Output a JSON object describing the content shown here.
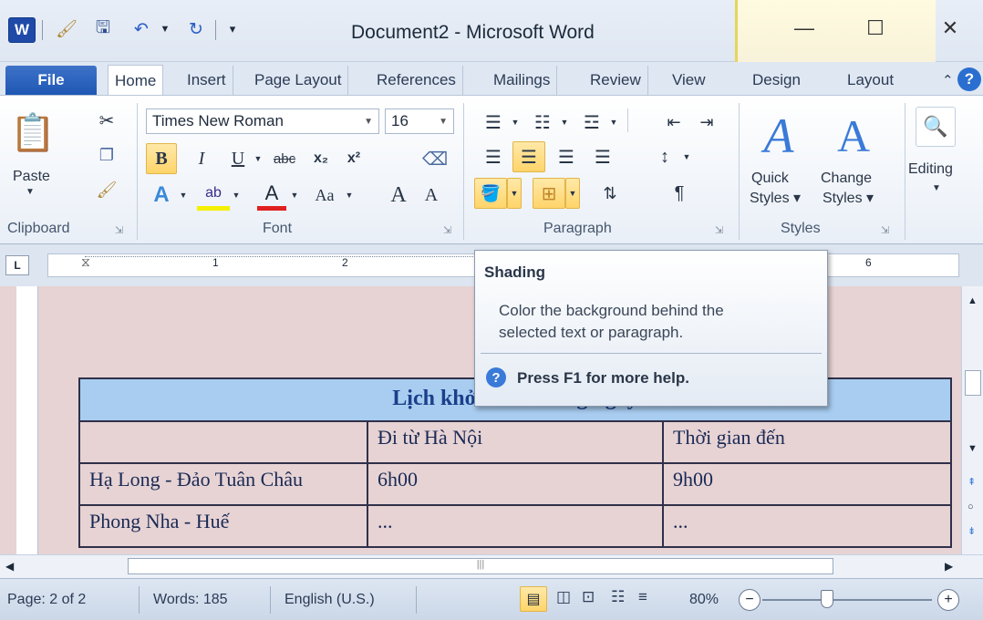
{
  "title_bar": {
    "document_title": "Document2 - Microsoft Word",
    "app_icon_letter": "W",
    "minimize_glyph": "—",
    "maximize_glyph": "☐",
    "close_glyph": "✕"
  },
  "tabs": [
    {
      "label": "File"
    },
    {
      "label": "Home"
    },
    {
      "label": "Insert"
    },
    {
      "label": "Page Layout"
    },
    {
      "label": "References"
    },
    {
      "label": "Mailings"
    },
    {
      "label": "Review"
    },
    {
      "label": "View"
    },
    {
      "label": "Design"
    },
    {
      "label": "Layout"
    }
  ],
  "ribbon": {
    "clipboard": {
      "label": "Clipboard",
      "paste_label": "Paste"
    },
    "font": {
      "label": "Font",
      "font_name": "Times New Roman",
      "font_size": "16",
      "bold": "B",
      "italic": "I",
      "underline": "U",
      "strikethrough": "abc",
      "subscript": "x₂",
      "superscript": "x²",
      "change_case": "Aa",
      "grow": "A",
      "shrink": "A"
    },
    "paragraph": {
      "label": "Paragraph",
      "pilcrow": "¶"
    },
    "styles": {
      "label": "Styles",
      "quick_styles": "Quick",
      "quick_styles_2": "Styles",
      "change_styles": "Change",
      "change_styles_2": "Styles"
    },
    "editing": {
      "label": "Editing"
    }
  },
  "ruler": {
    "marks": [
      "1",
      "2",
      "6"
    ]
  },
  "tooltip": {
    "title": "Shading",
    "description_line1": "Color the background behind the",
    "description_line2": "selected text or paragraph.",
    "help": "Press F1 for more help."
  },
  "document_table": {
    "title": "Lịch khởi hành hàng ngày",
    "rows": [
      [
        "",
        "Đi từ Hà Nội",
        "Thời gian đến"
      ],
      [
        "Hạ Long - Đảo Tuân Châu",
        "6h00",
        "9h00"
      ],
      [
        "Phong Nha - Huế",
        "...",
        "..."
      ]
    ]
  },
  "status_bar": {
    "page": "Page: 2 of 2",
    "words": "Words: 185",
    "language": "English (U.S.)",
    "zoom": "80%"
  },
  "colors": {
    "accent": "#1f57b4",
    "document_background": "#e7d3d4",
    "table_header": "#a8cdf0",
    "highlight": "#ffd46a"
  }
}
